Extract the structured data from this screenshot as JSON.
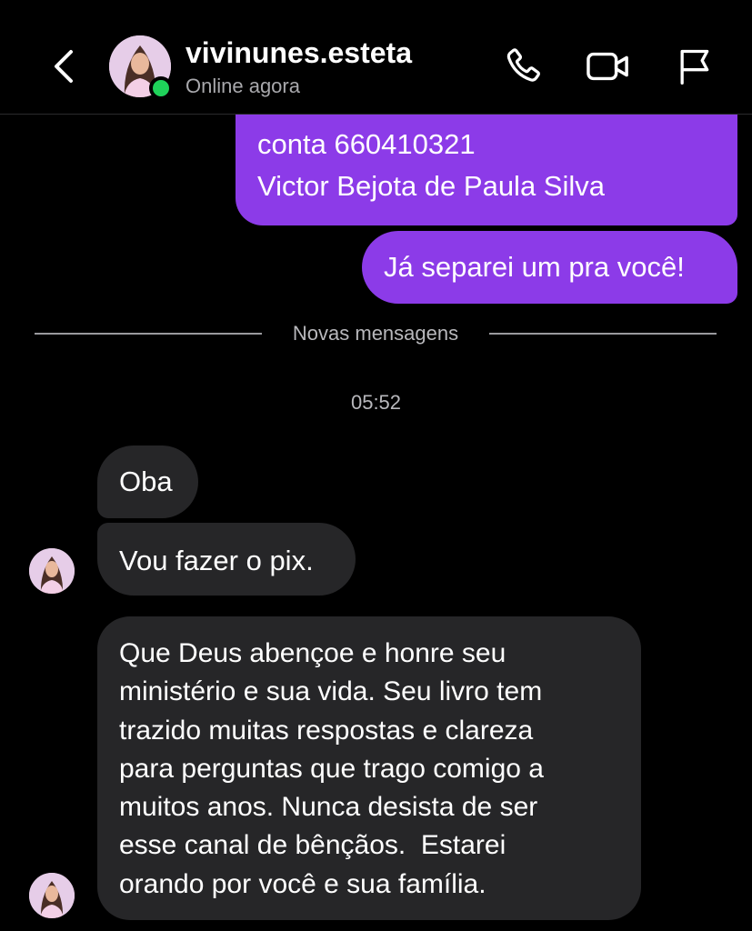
{
  "header": {
    "username": "vivinunes.esteta",
    "status": "Online agora"
  },
  "messages": {
    "outgoing_1": {
      "lines": [
        "conta 660410321",
        "Victor Bejota de Paula Silva"
      ]
    },
    "outgoing_2": "Já separei um pra você!",
    "divider_label": "Novas mensagens",
    "timestamp": "05:52",
    "incoming_1": "Oba",
    "incoming_2": "Vou fazer o pix.",
    "incoming_3": {
      "lines": [
        "Que Deus abençoe e honre seu",
        "ministério e sua vida. Seu livro tem",
        "trazido muitas respostas e clareza",
        "para perguntas que trago comigo a",
        "muitos anos. Nunca desista de ser",
        "esse canal de bênçãos.  Estarei",
        "orando por você e sua família."
      ]
    }
  },
  "colors": {
    "outgoing_bubble": "#8c3be8",
    "incoming_bubble": "#262628",
    "online_dot": "#1fd25a",
    "background": "#000000"
  },
  "icons": [
    "back-chevron-icon",
    "phone-icon",
    "video-camera-icon",
    "flag-icon"
  ]
}
